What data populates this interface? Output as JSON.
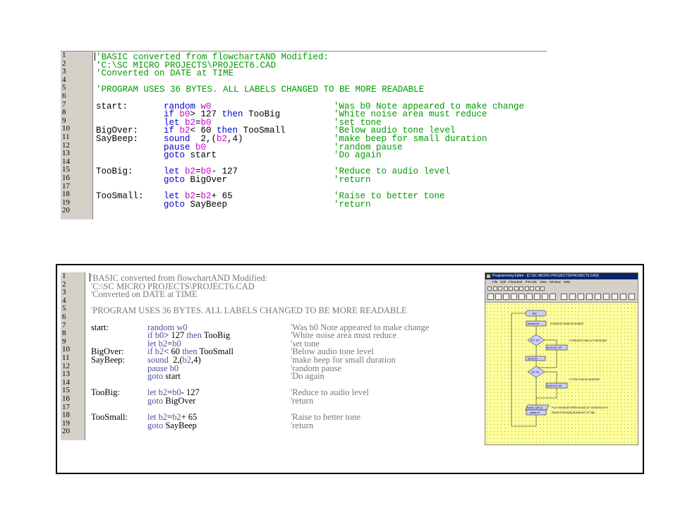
{
  "code_lines": [
    {
      "n": "1",
      "comment": "'BASIC converted from flowchartAND Modified:"
    },
    {
      "n": "2",
      "comment": "'C:\\SC MICRO PROJECTS\\PROJECT6.CAD"
    },
    {
      "n": "3",
      "comment": "'Converted on DATE at TIME"
    },
    {
      "n": "4"
    },
    {
      "n": "5",
      "comment": "'PROGRAM USES 36 BYTES. ALL LABELS CHANGED TO BE MORE READABLE"
    },
    {
      "n": "6"
    },
    {
      "n": "7",
      "label": "start:",
      "code": [
        {
          "t": "random ",
          "k": "keyword"
        },
        {
          "t": "w0",
          "k": "var"
        }
      ],
      "comment": "'Was b0 Note appeared to make change"
    },
    {
      "n": "8",
      "code": [
        {
          "t": "if ",
          "k": "keyword"
        },
        {
          "t": "b0",
          "k": "var"
        },
        {
          "t": "> 127 ",
          "k": "text"
        },
        {
          "t": "then ",
          "k": "keyword"
        },
        {
          "t": "TooBig",
          "k": "text"
        }
      ],
      "comment": "'White noise area must reduce"
    },
    {
      "n": "9",
      "code": [
        {
          "t": "let ",
          "k": "keyword"
        },
        {
          "t": "b2",
          "k": "var"
        },
        {
          "t": "=",
          "k": "text"
        },
        {
          "t": "b0",
          "k": "var"
        }
      ],
      "comment": "'set tone"
    },
    {
      "n": "10",
      "label": "BigOver:",
      "code": [
        {
          "t": "if ",
          "k": "keyword"
        },
        {
          "t": "b2",
          "k": "var"
        },
        {
          "t": "< 60 ",
          "k": "text"
        },
        {
          "t": "then ",
          "k": "keyword"
        },
        {
          "t": "TooSmall",
          "k": "text"
        }
      ],
      "comment": "'Below audio tone level"
    },
    {
      "n": "11",
      "label": "SayBeep:",
      "code": [
        {
          "t": "sound ",
          "k": "keyword"
        },
        {
          "t": " 2,(",
          "k": "text"
        },
        {
          "t": "b2",
          "k": "var"
        },
        {
          "t": ",4)",
          "k": "text"
        }
      ],
      "comment": "'make beep for small duration"
    },
    {
      "n": "12",
      "code": [
        {
          "t": "pause ",
          "k": "keyword"
        },
        {
          "t": "b0",
          "k": "var"
        }
      ],
      "comment": "'random pause"
    },
    {
      "n": "13",
      "code": [
        {
          "t": "goto ",
          "k": "keyword"
        },
        {
          "t": "start",
          "k": "text"
        }
      ],
      "comment": "'Do again"
    },
    {
      "n": "14"
    },
    {
      "n": "15",
      "label": "TooBig:",
      "code": [
        {
          "t": "let ",
          "k": "keyword"
        },
        {
          "t": "b2",
          "k": "var"
        },
        {
          "t": "=",
          "k": "text"
        },
        {
          "t": "b0",
          "k": "var"
        },
        {
          "t": "- 127",
          "k": "text"
        }
      ],
      "comment": "'Reduce to audio level"
    },
    {
      "n": "16",
      "code": [
        {
          "t": "goto ",
          "k": "keyword"
        },
        {
          "t": "BigOver",
          "k": "text"
        }
      ],
      "comment": "'return"
    },
    {
      "n": "17"
    },
    {
      "n": "18",
      "label": "TooSmall:",
      "code": [
        {
          "t": "let ",
          "k": "keyword"
        },
        {
          "t": "b2",
          "k": "var"
        },
        {
          "t": "=",
          "k": "text"
        },
        {
          "t": "b2",
          "k": "var"
        },
        {
          "t": "+ 65",
          "k": "text"
        }
      ],
      "comment": "'Raise to better tone"
    },
    {
      "n": "19",
      "code": [
        {
          "t": "goto ",
          "k": "keyword"
        },
        {
          "t": "SayBeep",
          "k": "text"
        }
      ],
      "comment": "'return"
    },
    {
      "n": "20"
    }
  ],
  "editor": {
    "title": "Programming Editor - [C:\\SC MICRO PROJECTS\\PROJECT6.CAD]",
    "menu": [
      "File",
      "Edit",
      "Flowchart",
      "PICAXE",
      "View",
      "Window",
      "Help"
    ],
    "flowchart": {
      "start": "start",
      "random": "random  b0",
      "random_note": "GENERATE RANDOM NUMBER",
      "decision1": "b0> 127",
      "decision1_note": "IF GREATER THAN 127 DECREASE",
      "reduce": "let b2=b0- 127",
      "set": "let b2=b0",
      "decision2": "b2< 60",
      "decision2_note": "IF LESS THAN 60 INCREASE",
      "increase": "let b2=b2+ 65",
      "sound": "sound  2,(b2,4)",
      "sound_note": "PLAY SOUND BETWEEN 60 AND 127  DURATION OF 4",
      "pause": "pause b0",
      "pause_note": "PAUSE FOR RANDOM AMOUNT OF TIME"
    }
  },
  "colors": {
    "comment": "#009900",
    "keyword": "#0000cc",
    "variable": "#cc00cc",
    "gutter": "#d4d0c8",
    "flowchart_bg": "#ffff99",
    "flowchart_box": "#ccccff"
  }
}
